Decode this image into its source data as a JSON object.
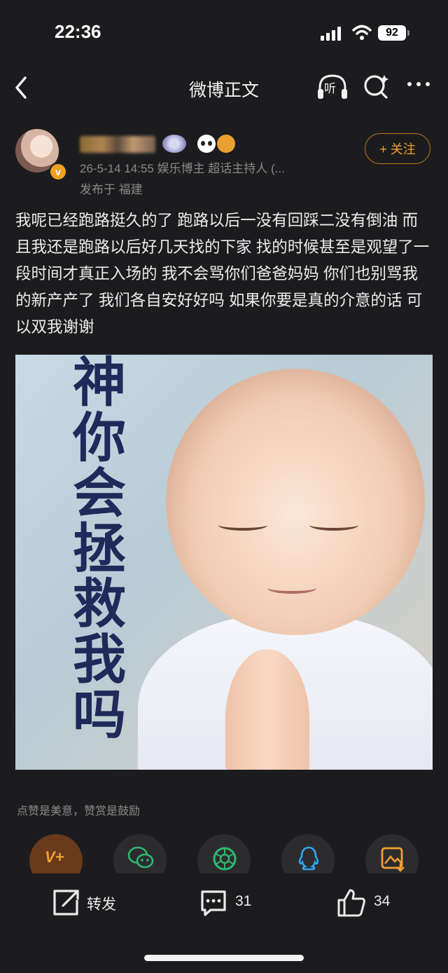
{
  "status_bar": {
    "time": "22:36",
    "battery": "92"
  },
  "nav": {
    "title": "微博正文",
    "listen_label": "听"
  },
  "post": {
    "meta": "26-5-14 14:55  娱乐博主 超话主持人 (...",
    "location": "发布于 福建",
    "follow_label": "+ 关注",
    "avatar_badge": "v",
    "text": "我呢已经跑路挺久的了 跑路以后一没有回踩二没有倒油 而且我还是跑路以后好几天找的下家 找的时候甚至是观望了一段时间才真正入场的 我不会骂你们爸爸妈妈 你们也别骂我的新产产了 我们各自安好好吗 如果你要是真的介意的话 可以双我谢谢",
    "image_text": [
      "神",
      "你",
      "会",
      "拯",
      "救",
      "我",
      "吗"
    ]
  },
  "reward": {
    "text": "点赞是美意，赞赏是鼓励",
    "vplus_label": "V+"
  },
  "actions": {
    "repost_label": "转发",
    "comment_count": "31",
    "like_count": "34"
  },
  "colors": {
    "background": "#1c1c1e",
    "accent": "#f0a030"
  }
}
